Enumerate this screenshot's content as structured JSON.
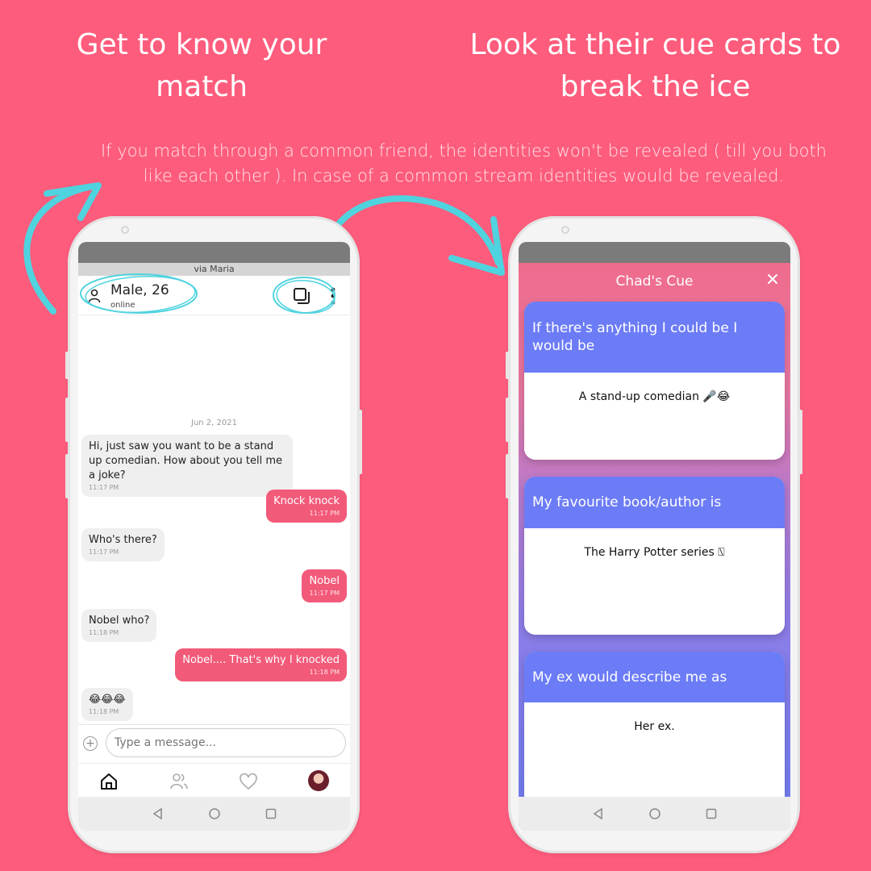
{
  "headlines": {
    "left": "Get to know your match",
    "right": "Look at their cue cards to break the ice"
  },
  "note": "If you match through a common friend, the identities won't be revealed ( till you both like each other ). In case of a common stream identities would be revealed.",
  "colors": {
    "background": "#fe5c7c",
    "accent_arrow": "#4fd3df",
    "outgoing_bubble": "#f25a7a",
    "cue_question_bg": "#6c7cf6"
  },
  "chat": {
    "via": "via Maria",
    "user_title": "Male, 26",
    "user_status": "online",
    "date": "Jun 2, 2021",
    "messages": [
      {
        "dir": "in",
        "text": "Hi, just saw you want to be a stand up comedian. How about you tell me a joke?",
        "time": "11:17 PM"
      },
      {
        "dir": "out",
        "text": "Knock knock",
        "time": "11:17 PM"
      },
      {
        "dir": "in",
        "text": "Who's there?",
        "time": "11:17 PM"
      },
      {
        "dir": "out",
        "text": "Nobel",
        "time": "11:17 PM"
      },
      {
        "dir": "in",
        "text": "Nobel who?",
        "time": "11:18 PM"
      },
      {
        "dir": "out",
        "text": "Nobel.... That's why I knocked",
        "time": "11:18 PM"
      },
      {
        "dir": "in",
        "text": "😂😂😂",
        "time": "11:18 PM"
      }
    ],
    "input_placeholder": "Type a message...",
    "nav_icons": [
      "home-icon",
      "friends-icon",
      "heart-icon",
      "avatar"
    ]
  },
  "cue": {
    "title": "Chad's Cue",
    "cards": [
      {
        "question": "If there's anything I could be I would be",
        "answer": "A stand-up comedian 🎤😂"
      },
      {
        "question": "My favourite book/author is",
        "answer": "The Harry Potter series ⍂"
      },
      {
        "question": "My ex would describe me as",
        "answer": "Her ex."
      }
    ]
  }
}
